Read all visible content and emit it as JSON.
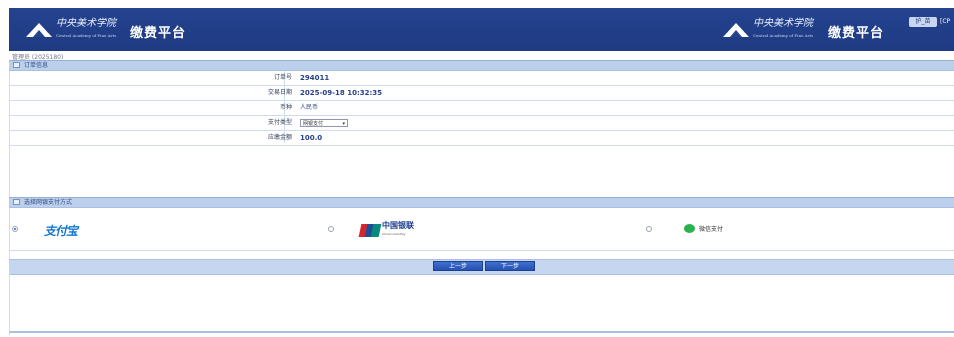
{
  "header": {
    "logo_cn": "中央美术学院",
    "logo_en": "Central Academy of Fine Arts",
    "platform_title": "缴费平台",
    "user_badge": "护_苗",
    "user_extra": "[CP"
  },
  "breadcrumb": "管理员 (2025180)",
  "order_section": {
    "title": "订单信息",
    "rows": [
      {
        "label": "订单号",
        "value": "294011"
      },
      {
        "label": "交易日期",
        "value": "2025-09-18 10:32:35"
      },
      {
        "label": "币种",
        "value": "人民币"
      },
      {
        "label": "支付类型",
        "select": "网银支付"
      },
      {
        "label": "应缴金额",
        "value": "100.0"
      }
    ]
  },
  "payment_section": {
    "title": "选择网银支付方式",
    "options": [
      {
        "name": "alipay",
        "label": "支付宝",
        "selected": true
      },
      {
        "name": "unionpay",
        "label": "中国银联",
        "label_en": "China UnionPay",
        "selected": false
      },
      {
        "name": "wechat",
        "label": "微信支付",
        "selected": false
      }
    ]
  },
  "buttons": {
    "prev": "上一步",
    "next": "下一步"
  },
  "colors": {
    "header_bg": "#24438f",
    "accent": "#2652b0",
    "value_text": "#27408b",
    "alipay": "#1677d2",
    "wechat": "#2bb24c"
  }
}
